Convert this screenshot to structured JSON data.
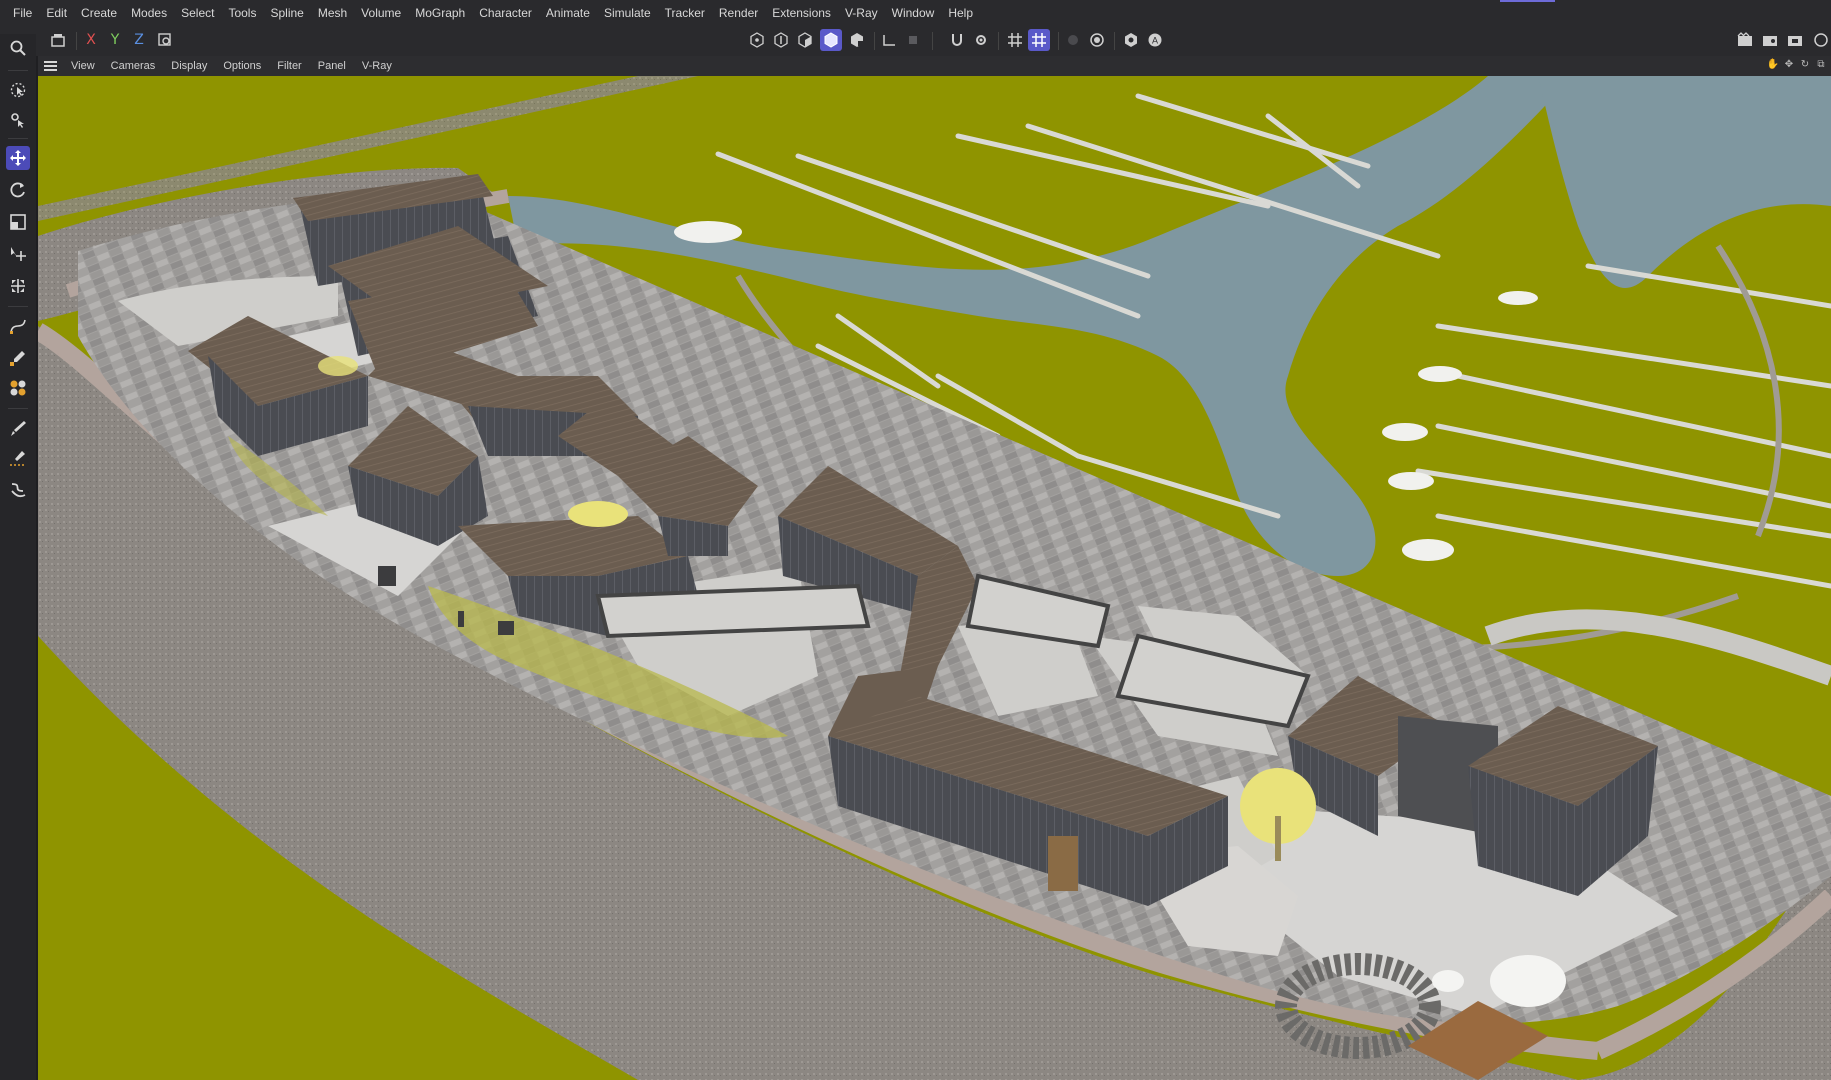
{
  "menubar": {
    "items": [
      "File",
      "Edit",
      "Create",
      "Modes",
      "Select",
      "Tools",
      "Spline",
      "Mesh",
      "Volume",
      "MoGraph",
      "Character",
      "Animate",
      "Simulate",
      "Tracker",
      "Render",
      "Extensions",
      "V-Ray",
      "Window",
      "Help"
    ]
  },
  "toolbar": {
    "axis_x": "X",
    "axis_y": "Y",
    "axis_z": "Z",
    "icons": [
      "undo-icon",
      "lock-icon",
      "points-mode-icon",
      "edges-mode-icon",
      "polygons-mode-icon",
      "model-mode-icon",
      "texture-mode-icon",
      "workplane-icon",
      "snap-icon",
      "snap-settings-icon",
      "grid-icon",
      "grid-snap-icon",
      "render-region-icon",
      "render-view-icon",
      "render-picture-viewer-icon",
      "render-settings-icon",
      "vray-icon",
      "vray-ipr-icon"
    ]
  },
  "viewport_menu": {
    "items": [
      "View",
      "Cameras",
      "Display",
      "Options",
      "Filter",
      "Panel",
      "V-Ray"
    ]
  },
  "left_palette": {
    "tools": [
      "search-icon",
      "live-selection-icon",
      "transfer-icon",
      "move-icon",
      "rotate-icon",
      "scale-icon",
      "move-child-icon",
      "scale-child-icon",
      "spline-pen-icon",
      "sketch-icon",
      "paint-icon",
      "brush-icon",
      "knife-icon",
      "twist-icon"
    ]
  },
  "colors": {
    "accent": "#5a59c9",
    "terrain": "#8f9400",
    "water": "#7f97a0",
    "pavement": "#9e9c9a",
    "roof": "#6b5b4e",
    "road": "#8a8580",
    "axis_x": "#e05050",
    "axis_y": "#7fcf5f",
    "axis_z": "#5a8fe0"
  }
}
